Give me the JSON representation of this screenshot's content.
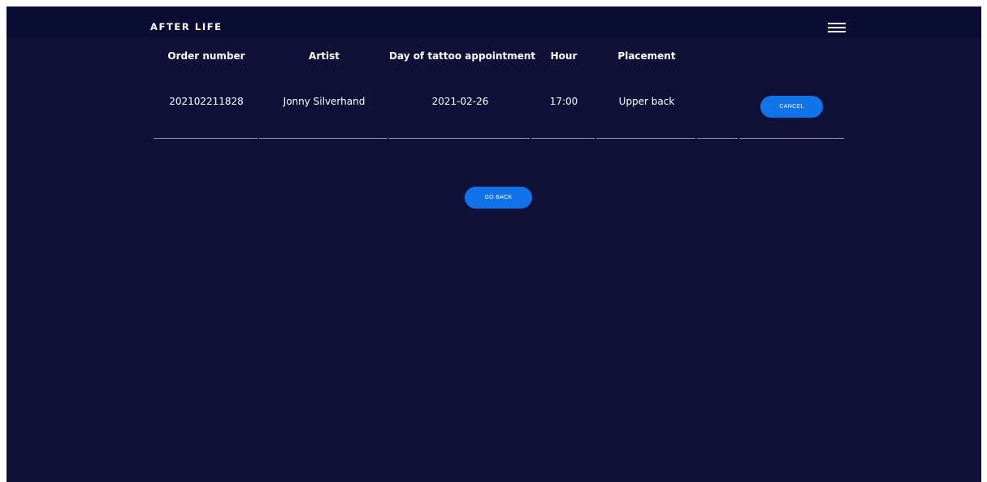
{
  "header": {
    "brand": "AFTER LIFE",
    "menu_icon": "hamburger-menu-icon"
  },
  "table": {
    "columns": [
      "Order number",
      "Artist",
      "Day of tattoo appointment",
      "Hour",
      "Placement",
      ""
    ],
    "rows": [
      {
        "order_number": "202102211828",
        "artist": "Jonny Silverhand",
        "date": "2021-02-26",
        "hour": "17:00",
        "placement": "Upper back",
        "action_label": "CANCEL"
      }
    ]
  },
  "actions": {
    "go_back_label": "GO BACK"
  },
  "colors": {
    "background": "#0f1139",
    "navbar": "#0a0d33",
    "accent": "#1273e8",
    "text": "#ffffff",
    "divider": "#8e90a8"
  }
}
